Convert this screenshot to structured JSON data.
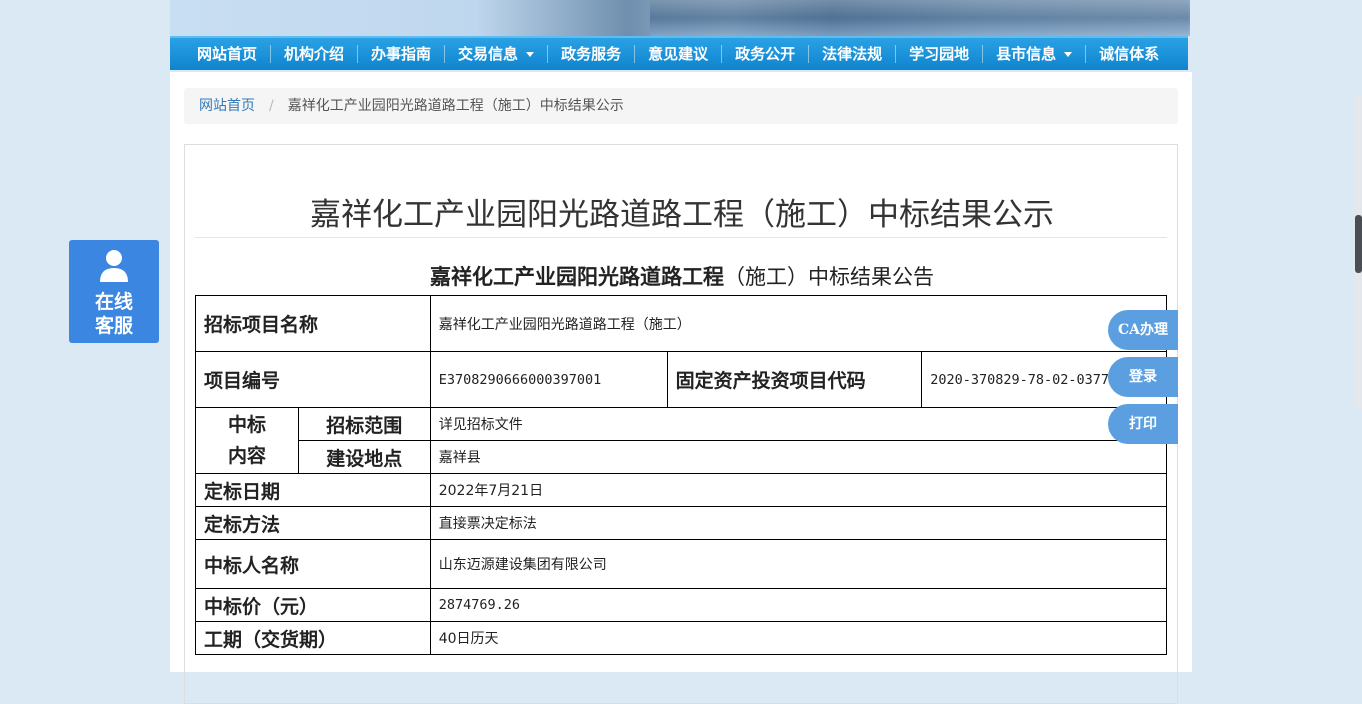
{
  "nav": {
    "items": [
      {
        "label": "网站首页",
        "dropdown": false
      },
      {
        "label": "机构介绍",
        "dropdown": false
      },
      {
        "label": "办事指南",
        "dropdown": false
      },
      {
        "label": "交易信息",
        "dropdown": true
      },
      {
        "label": "政务服务",
        "dropdown": false
      },
      {
        "label": "意见建议",
        "dropdown": false
      },
      {
        "label": "政务公开",
        "dropdown": false
      },
      {
        "label": "法律法规",
        "dropdown": false
      },
      {
        "label": "学习园地",
        "dropdown": false
      },
      {
        "label": "县市信息",
        "dropdown": true
      },
      {
        "label": "诚信体系",
        "dropdown": false
      }
    ]
  },
  "breadcrumb": {
    "home": "网站首页",
    "separator": "/",
    "current": "嘉祥化工产业园阳光路道路工程（施工）中标结果公示"
  },
  "page_title": "嘉祥化工产业园阳光路道路工程（施工）中标结果公示",
  "doc_title": {
    "bold": "嘉祥化工产业园阳光路道路工程",
    "normal": "（施工）中标结果公告"
  },
  "table": {
    "project_name_label": "招标项目名称",
    "project_name": "嘉祥化工产业园阳光路道路工程（施工）",
    "project_no_label": "项目编号",
    "project_no": "E3708290666000397001",
    "invest_code_label": "固定资产投资项目代码",
    "invest_code": "2020-370829-78-02-037731",
    "content_label": "中标内容",
    "content_label_line1": "中标",
    "content_label_line2": "内容",
    "scope_label": "招标范围",
    "scope": "详见招标文件",
    "location_label": "建设地点",
    "location": "嘉祥县",
    "date_label": "定标日期",
    "date": "2022年7月21日",
    "method_label": "定标方法",
    "method": "直接票决定标法",
    "winner_label": "中标人名称",
    "winner": "山东迈源建设集团有限公司",
    "price_label": "中标价（元）",
    "price": "2874769.26",
    "period_label": "工期（交货期）",
    "period": "40日历天"
  },
  "kefu": {
    "line1": "在线",
    "line2": "客服"
  },
  "side_buttons": {
    "ca": "CA办理",
    "login": "登录",
    "print": "打印"
  },
  "colors": {
    "nav": "#1690d8",
    "accent": "#337ab7",
    "kefu": "#3a86e0",
    "side": "#5b9fe0"
  }
}
